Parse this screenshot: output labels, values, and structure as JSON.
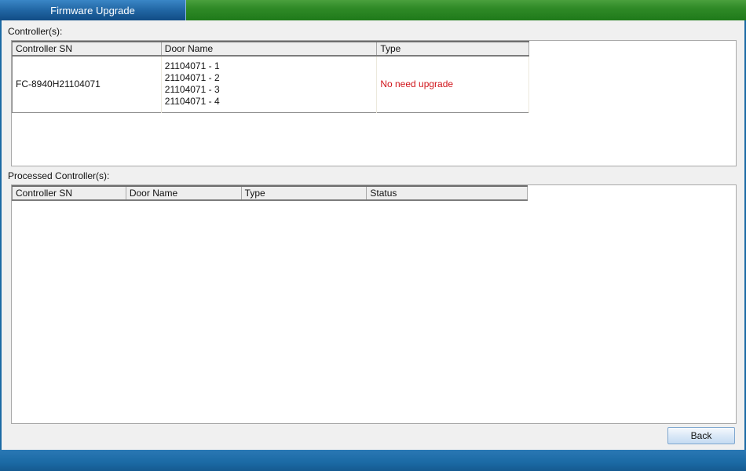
{
  "header": {
    "tab_label": "Firmware Upgrade"
  },
  "controllers": {
    "section_label": "Controller(s):",
    "columns": [
      "Controller SN",
      "Door Name",
      "Type"
    ],
    "rows": [
      {
        "sn": "FC-8940H21104071",
        "doors": [
          "21104071 - 1",
          "21104071 - 2",
          "21104071 - 3",
          "21104071 - 4"
        ],
        "type": "No need upgrade"
      }
    ]
  },
  "processed": {
    "section_label": "Processed Controller(s):",
    "columns": [
      "Controller SN",
      "Door Name",
      "Type",
      "Status"
    ],
    "rows": []
  },
  "buttons": {
    "back_label": "Back"
  },
  "colors": {
    "accent_blue": "#1b6aa5",
    "header_green": "#2f8a27",
    "type_status_red": "#d0141a"
  }
}
